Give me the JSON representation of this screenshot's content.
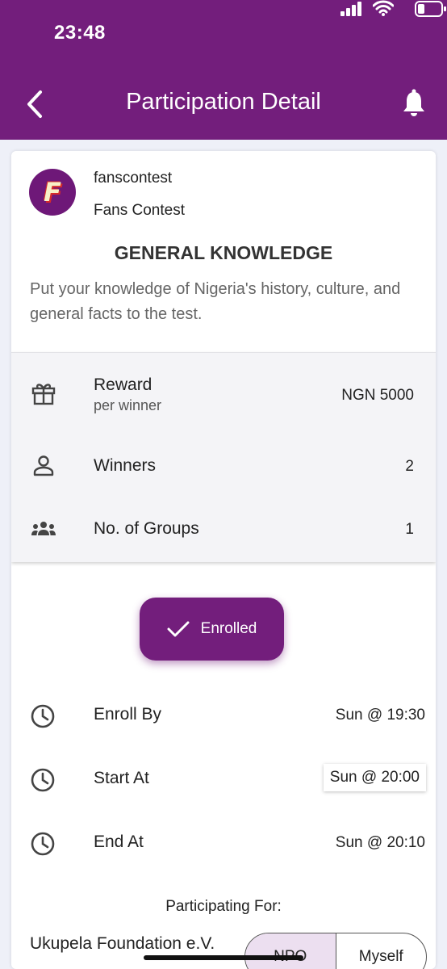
{
  "status_bar": {
    "time": "23:48"
  },
  "header": {
    "title": "Participation Detail"
  },
  "organizer": {
    "handle": "fanscontest",
    "name": "Fans Contest",
    "logo_letter": "F"
  },
  "contest": {
    "title": "GENERAL KNOWLEDGE",
    "description": "Put your knowledge of Nigeria's history, culture, and general facts to the test."
  },
  "info": {
    "reward": {
      "label": "Reward",
      "sub": "per winner",
      "value": "NGN 5000",
      "icon": "gift-icon"
    },
    "winners": {
      "label": "Winners",
      "value": "2",
      "icon": "person-icon"
    },
    "groups": {
      "label": "No. of Groups",
      "value": "1",
      "icon": "groups-icon"
    }
  },
  "enroll_button": {
    "label": "Enrolled"
  },
  "schedule": {
    "enroll_by": {
      "label": "Enroll By",
      "value": "Sun @ 19:30"
    },
    "start_at": {
      "label": "Start At",
      "value": "Sun @ 20:00"
    },
    "end_at": {
      "label": "End At",
      "value": "Sun @ 20:10"
    }
  },
  "participation": {
    "label": "Participating For:",
    "beneficiary": "Ukupela Foundation e.V.",
    "options": [
      "NPO",
      "Myself"
    ],
    "selected": "NPO"
  },
  "colors": {
    "brand": "#731e7c",
    "panel": "#f4f4f7",
    "selected_segment": "#ecdff0"
  }
}
